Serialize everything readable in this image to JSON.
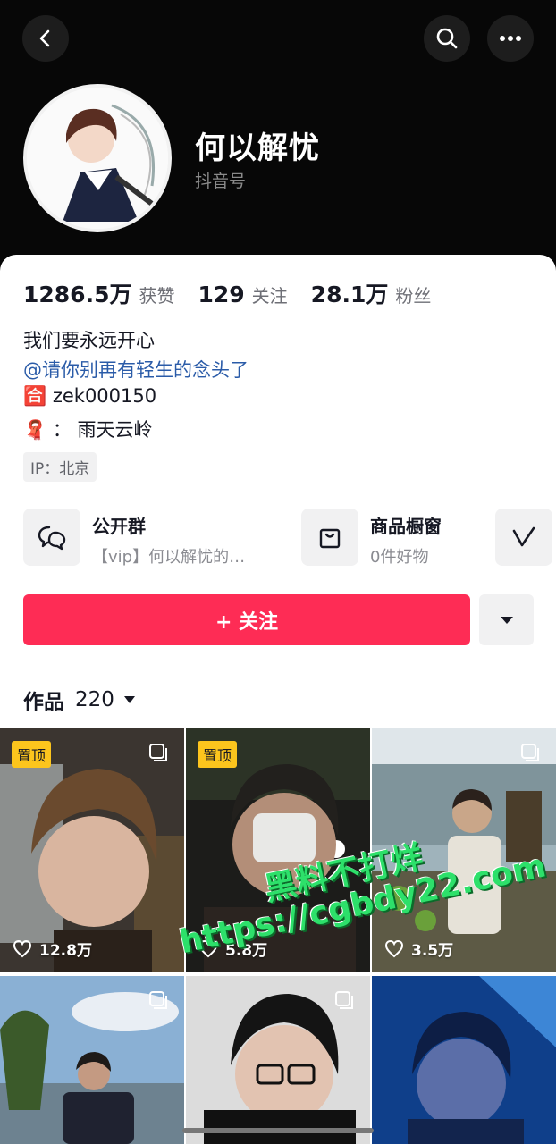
{
  "profile": {
    "name": "何以解忧",
    "handle_prefix": "抖音号"
  },
  "stats": [
    {
      "value": "1286.5万",
      "label": "获赞"
    },
    {
      "value": "129",
      "label": "关注"
    },
    {
      "value": "28.1万",
      "label": "粉丝"
    }
  ],
  "bio": {
    "line1": "我们要永远开心",
    "line2": "@请你别再有轻生的念头了",
    "line3_icon": "🈴",
    "line3": "zek000150",
    "line4_icon": "🧣",
    "line4": "：  雨天云岭"
  },
  "ip": "IP：北京",
  "features": {
    "group_title": "公开群",
    "group_sub": "【vip】何以解忧的…",
    "shop_title": "商品橱窗",
    "shop_sub": "0件好物"
  },
  "follow_button": "+ 关注",
  "works": {
    "label": "作品",
    "count": "220"
  },
  "videos": [
    {
      "pinned": "置顶",
      "likes": "12.8万"
    },
    {
      "pinned": "置顶",
      "likes": "5.8万"
    },
    {
      "pinned": "",
      "likes": "3.5万"
    },
    {
      "pinned": "",
      "likes": ""
    },
    {
      "pinned": "",
      "likes": ""
    },
    {
      "pinned": "",
      "likes": ""
    }
  ],
  "watermark": {
    "line1": "黑料不打烊",
    "line2": "https://cgbdy22.com"
  },
  "colors": {
    "accent": "#fe2c55",
    "pin_badge": "#fcc51d",
    "link": "#2a5ba8"
  }
}
